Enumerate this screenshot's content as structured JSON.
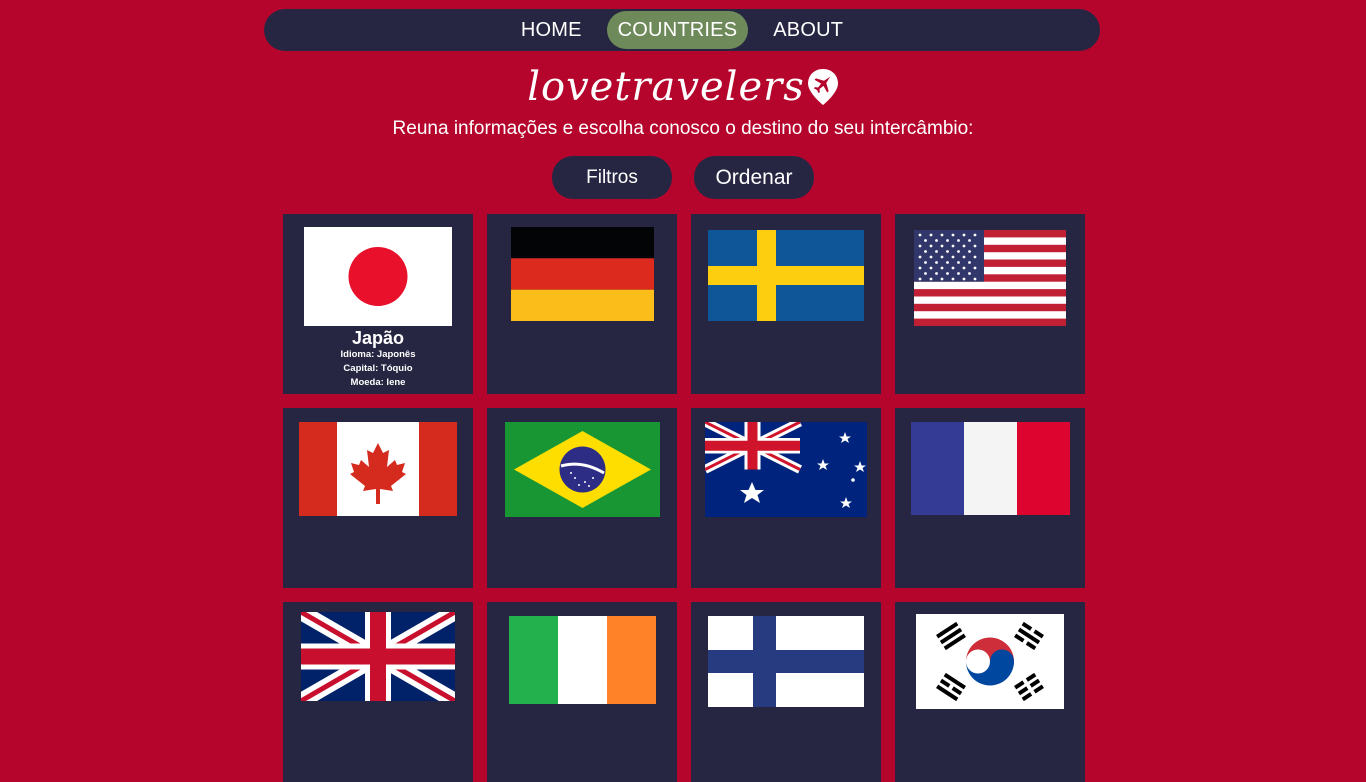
{
  "nav": {
    "items": [
      {
        "label": "HOME",
        "active": false
      },
      {
        "label": "COUNTRIES",
        "active": true
      },
      {
        "label": "ABOUT",
        "active": false
      }
    ]
  },
  "brand": {
    "logo_text": "lovetravelers",
    "logo_icon": "airplane-pin-icon"
  },
  "subtitle": "Reuna informações e escolha conosco o destino do seu intercâmbio:",
  "actions": {
    "filter_label": "Filtros",
    "sort_label": "Ordenar"
  },
  "colors": {
    "background": "#b5052c",
    "panel": "#262643",
    "active_nav": "#6f8a5a"
  },
  "countries": [
    {
      "flag": "japan-flag-icon",
      "name": "Japão",
      "idioma": "Idioma: Japonês",
      "capital": "Capital: Tóquio",
      "moeda": "Moeda: Iene"
    },
    {
      "flag": "germany-flag-icon"
    },
    {
      "flag": "sweden-flag-icon"
    },
    {
      "flag": "usa-flag-icon"
    },
    {
      "flag": "canada-flag-icon"
    },
    {
      "flag": "brazil-flag-icon"
    },
    {
      "flag": "australia-flag-icon"
    },
    {
      "flag": "france-flag-icon"
    },
    {
      "flag": "uk-flag-icon"
    },
    {
      "flag": "ireland-flag-icon"
    },
    {
      "flag": "finland-flag-icon"
    },
    {
      "flag": "south-korea-flag-icon"
    }
  ]
}
